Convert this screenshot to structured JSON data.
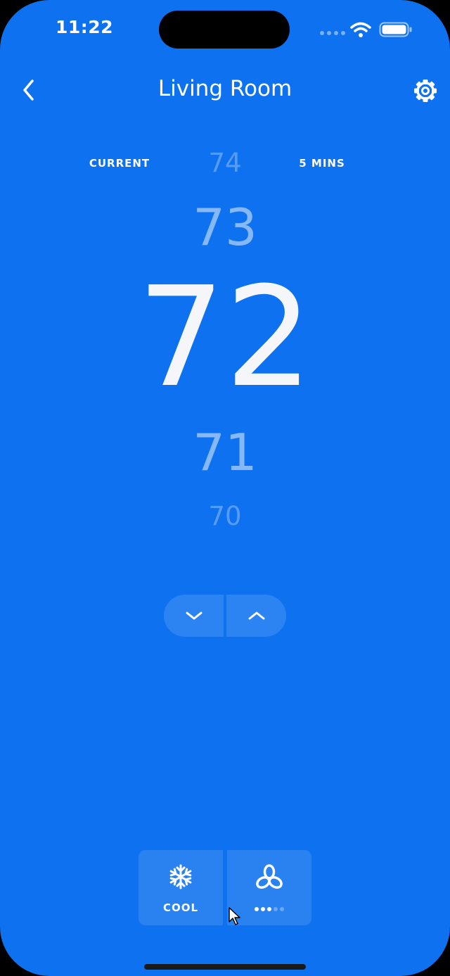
{
  "status_bar": {
    "time": "11:22",
    "signal_icon": "cellular-signal-icon",
    "wifi_icon": "wifi-icon",
    "battery_icon": "battery-icon"
  },
  "nav": {
    "title": "Living Room",
    "back_icon": "chevron-left-icon",
    "settings_icon": "gear-icon"
  },
  "labels": {
    "current": "CURRENT",
    "timer": "5 MINS"
  },
  "temperature": {
    "selected": "72",
    "far_above": "74",
    "above": "73",
    "below": "71",
    "far_below": "70"
  },
  "stepper": {
    "down_icon": "chevron-down-icon",
    "up_icon": "chevron-up-icon"
  },
  "modes": {
    "cool": {
      "label": "COOL",
      "icon": "snowflake-icon"
    },
    "fan": {
      "icon": "fan-icon",
      "level": 3,
      "max_level": 5
    }
  },
  "colors": {
    "background": "#0d71f0",
    "text": "#ffffff"
  }
}
